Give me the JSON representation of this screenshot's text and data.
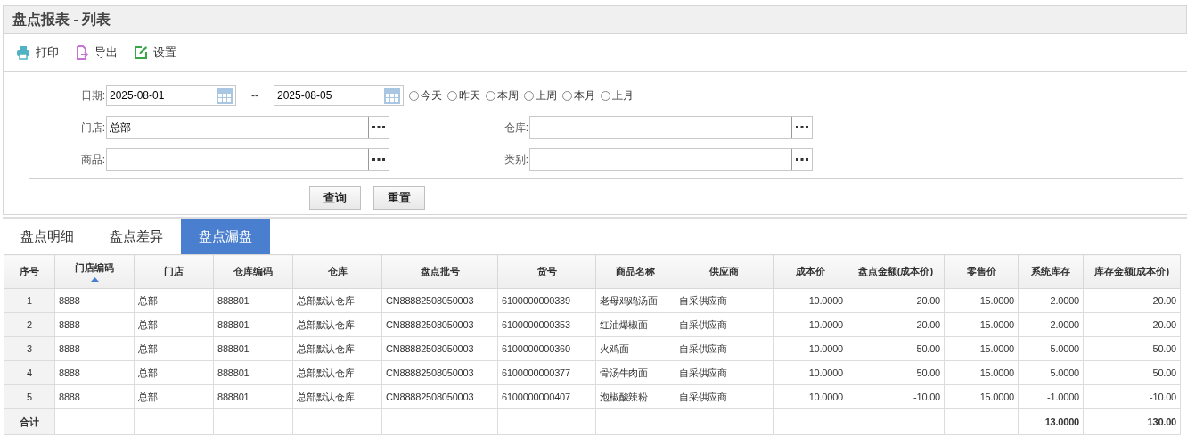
{
  "window": {
    "title": "盘点报表 - 列表"
  },
  "toolbar": [
    {
      "kind": "print",
      "label": "打印"
    },
    {
      "kind": "export",
      "label": "导出"
    },
    {
      "kind": "settings",
      "label": "设置"
    }
  ],
  "filters": {
    "date": {
      "label": "日期:",
      "from": "2025-08-01",
      "separator": "--",
      "to": "2025-08-05"
    },
    "quick_ranges": [
      {
        "label": "今天",
        "selected": false
      },
      {
        "label": "昨天",
        "selected": false
      },
      {
        "label": "本周",
        "selected": false
      },
      {
        "label": "上周",
        "selected": false
      },
      {
        "label": "本月",
        "selected": false
      },
      {
        "label": "上月",
        "selected": false
      }
    ],
    "pickers": [
      {
        "label": "门店:",
        "value": "总部"
      },
      {
        "label": "仓库:"
      },
      {
        "label": "商品:"
      },
      {
        "label": "类别:"
      }
    ],
    "buttons": [
      "查询",
      "重置"
    ]
  },
  "tabs": [
    {
      "label": "盘点明细",
      "selected": false
    },
    {
      "label": "盘点差异",
      "selected": false
    },
    {
      "label": "盘点漏盘",
      "selected": true
    }
  ],
  "table": {
    "columns": [
      {
        "label": "序号",
        "kind": "index",
        "sorted": false
      },
      {
        "label": "门店编码",
        "kind": "text",
        "sorted": true
      },
      {
        "label": "门店",
        "kind": "text",
        "sorted": false
      },
      {
        "label": "仓库编码",
        "kind": "text",
        "sorted": false
      },
      {
        "label": "仓库",
        "kind": "text",
        "sorted": false
      },
      {
        "label": "盘点批号",
        "kind": "text",
        "sorted": false
      },
      {
        "label": "货号",
        "kind": "text",
        "sorted": false
      },
      {
        "label": "商品名称",
        "kind": "text",
        "sorted": false
      },
      {
        "label": "供应商",
        "kind": "text",
        "sorted": false
      },
      {
        "label": "成本价",
        "kind": "number",
        "sorted": false
      },
      {
        "label": "盘点金额(成本价)",
        "kind": "number",
        "sorted": false
      },
      {
        "label": "零售价",
        "kind": "number",
        "sorted": false
      },
      {
        "label": "系统库存",
        "kind": "number",
        "sorted": false
      },
      {
        "label": "库存金额(成本价)",
        "kind": "number",
        "sorted": false
      }
    ],
    "rows": [
      [
        "1",
        "8888",
        "总部",
        "888801",
        "总部默认仓库",
        "CN88882508050003",
        "6100000000339",
        "老母鸡鸡汤面",
        "自采供应商",
        "10.0000",
        "20.00",
        "15.0000",
        "2.0000",
        "20.00"
      ],
      [
        "2",
        "8888",
        "总部",
        "888801",
        "总部默认仓库",
        "CN88882508050003",
        "6100000000353",
        "红油爆椒面",
        "自采供应商",
        "10.0000",
        "20.00",
        "15.0000",
        "2.0000",
        "20.00"
      ],
      [
        "3",
        "8888",
        "总部",
        "888801",
        "总部默认仓库",
        "CN88882508050003",
        "6100000000360",
        "火鸡面",
        "自采供应商",
        "10.0000",
        "50.00",
        "15.0000",
        "5.0000",
        "50.00"
      ],
      [
        "4",
        "8888",
        "总部",
        "888801",
        "总部默认仓库",
        "CN88882508050003",
        "6100000000377",
        "骨汤牛肉面",
        "自采供应商",
        "10.0000",
        "50.00",
        "15.0000",
        "5.0000",
        "50.00"
      ],
      [
        "5",
        "8888",
        "总部",
        "888801",
        "总部默认仓库",
        "CN88882508050003",
        "6100000000407",
        "泡椒酸辣粉",
        "自采供应商",
        "10.0000",
        "-10.00",
        "15.0000",
        "-1.0000",
        "-10.00"
      ]
    ],
    "totals": {
      "label": "合计",
      "trailing": [
        "13.0000",
        "130.00"
      ]
    }
  }
}
